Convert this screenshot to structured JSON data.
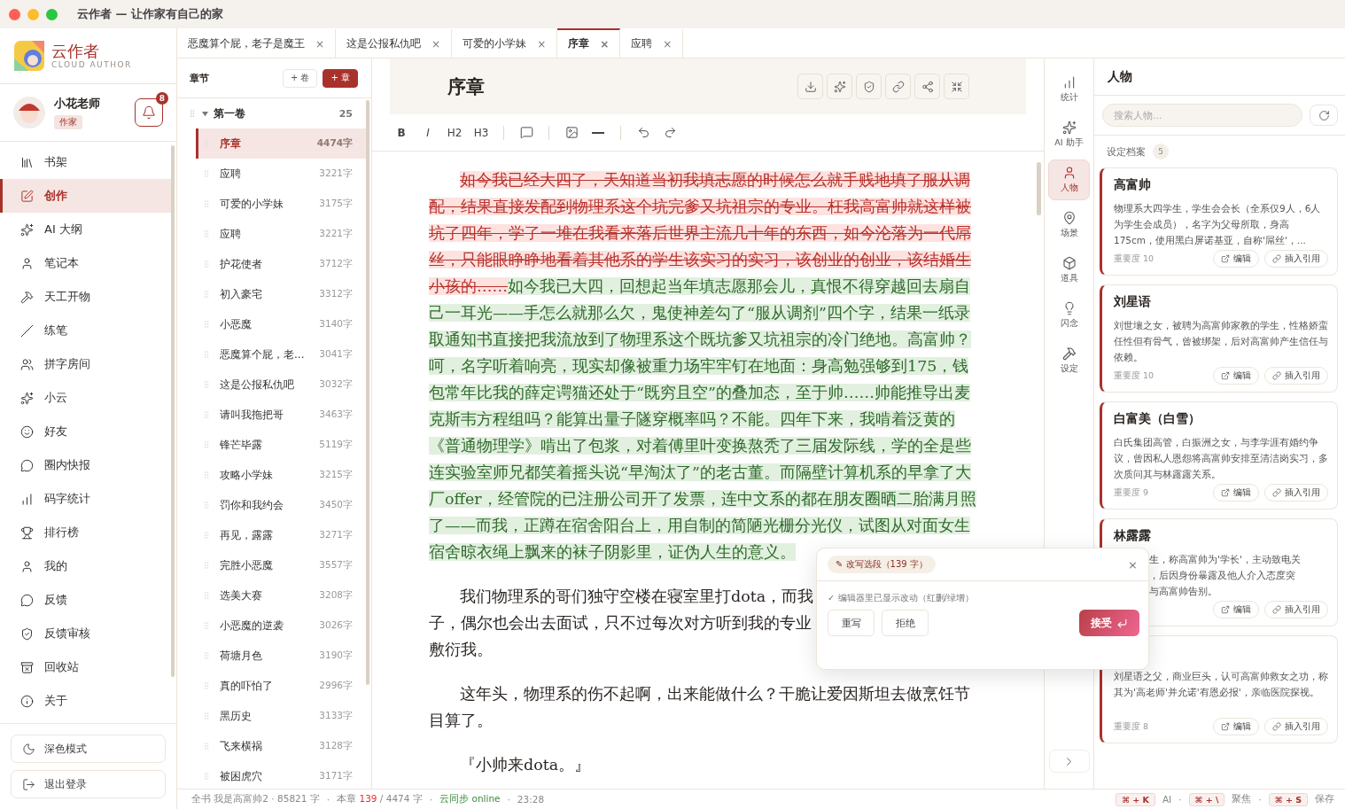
{
  "window": {
    "title": "云作者 — 让作家有自己的家"
  },
  "brand": {
    "name": "云作者",
    "subtitle": "CLOUD AUTHOR"
  },
  "user": {
    "name": "小花老师",
    "role": "作家",
    "notifications": "8"
  },
  "nav": [
    {
      "label": "书架",
      "selected": false
    },
    {
      "label": "创作",
      "selected": true
    },
    {
      "label": "AI 大纲",
      "selected": false
    },
    {
      "label": "笔记本",
      "selected": false
    },
    {
      "label": "天工开物",
      "selected": false
    },
    {
      "label": "练笔",
      "selected": false
    },
    {
      "label": "拼字房间",
      "selected": false
    },
    {
      "label": "小云",
      "selected": false
    },
    {
      "label": "好友",
      "selected": false
    },
    {
      "label": "圈内快报",
      "selected": false
    },
    {
      "label": "码字统计",
      "selected": false
    },
    {
      "label": "排行榜",
      "selected": false
    },
    {
      "label": "我的",
      "selected": false
    },
    {
      "label": "反馈",
      "selected": false
    },
    {
      "label": "反馈审核",
      "selected": false
    },
    {
      "label": "回收站",
      "selected": false
    },
    {
      "label": "关于",
      "selected": false
    }
  ],
  "sidebar_buttons": [
    "深色模式",
    "退出登录"
  ],
  "tabs": [
    {
      "label": "恶魔算个屁，老子是魔王",
      "selected": false,
      "close": "×"
    },
    {
      "label": "这是公报私仇吧",
      "selected": false,
      "close": "×"
    },
    {
      "label": "可爱的小学妹",
      "selected": false,
      "close": "×"
    },
    {
      "label": "序章",
      "selected": true,
      "close": "×"
    },
    {
      "label": "应聘",
      "selected": false,
      "close": "×"
    }
  ],
  "chapters": {
    "title": "章节",
    "buttons": [
      "+ 卷",
      "+ 章"
    ],
    "volume": {
      "title": "第一卷",
      "count": "25",
      "expanded": true
    },
    "items": [
      {
        "title": "序章",
        "words": "4474字",
        "selected": true
      },
      {
        "title": "应聘",
        "words": "3221字",
        "selected": false
      },
      {
        "title": "可爱的小学妹",
        "words": "3175字",
        "selected": false
      },
      {
        "title": "应聘",
        "words": "3221字",
        "selected": false
      },
      {
        "title": "护花使者",
        "words": "3712字",
        "selected": false
      },
      {
        "title": "初入豪宅",
        "words": "3312字",
        "selected": false
      },
      {
        "title": "小恶魔",
        "words": "3140字",
        "selected": false
      },
      {
        "title": "恶魔算个屁，老...",
        "words": "3041字",
        "selected": false
      },
      {
        "title": "这是公报私仇吧",
        "words": "3032字",
        "selected": false
      },
      {
        "title": "请叫我拖把哥",
        "words": "3463字",
        "selected": false
      },
      {
        "title": "锋芒毕露",
        "words": "5119字",
        "selected": false
      },
      {
        "title": "攻略小学妹",
        "words": "3215字",
        "selected": false
      },
      {
        "title": "罚你和我约会",
        "words": "3450字",
        "selected": false
      },
      {
        "title": "再见，露露",
        "words": "3271字",
        "selected": false
      },
      {
        "title": "完胜小恶魔",
        "words": "3557字",
        "selected": false
      },
      {
        "title": "选美大赛",
        "words": "3208字",
        "selected": false
      },
      {
        "title": "小恶魔的逆袭",
        "words": "3026字",
        "selected": false
      },
      {
        "title": "荷塘月色",
        "words": "3190字",
        "selected": false
      },
      {
        "title": "真的吓怕了",
        "words": "2996字",
        "selected": false
      },
      {
        "title": "黑历史",
        "words": "3133字",
        "selected": false
      },
      {
        "title": "飞来横祸",
        "words": "3128字",
        "selected": false
      },
      {
        "title": "被困虎穴",
        "words": "3171字",
        "selected": false
      }
    ]
  },
  "editor": {
    "title": "序章",
    "toolbar": [
      "B",
      "I",
      "H2",
      "H3"
    ],
    "paragraphs": [
      {
        "kind": "diff",
        "segments": [
          {
            "kind": "deleted",
            "text": "如今我已经大四了，天知道当初我填志愿的时候怎么就手贱地填了服从调配，结果直接发配到物理系这个坑完爹又坑祖宗的专业。枉我高富帅就这样被坑了四年，学了一堆在我看来落后世界主流几十年的东西，如今沦落为一代屌丝，只能眼睁睁地看着其他系的学生该实习的实习，该创业的创业，该结婚生小孩的……"
          },
          {
            "kind": "inserted",
            "text": "如今我已大四，回想起当年填志愿那会儿，真恨不得穿越回去扇自己一耳光——手怎么就那么欠，鬼使神差勾了“服从调剂”四个字，结果一纸录取通知书直接把我流放到了物理系这个既坑爹又坑祖宗的冷门绝地。高富帅？呵，名字听着响亮，现实却像被重力场牢牢钉在地面：身高勉强够到175，钱包常年比我的薛定谔猫还处于“既穷且空”的叠加态，至于帅……帅能推导出麦克斯韦方程组吗？能算出量子隧穿概率吗？不能。四年下来，我啃着泛黄的《普通物理学》啃出了包浆，对着傅里叶变换熬秃了三届发际线，学的全是些连实验室师兄都笑着摇头说“早淘汰了”的老古董。而隔壁计算机系的早拿了大厂offer，经管院的已注册公司开了发票，连中文系的都在朋友圈晒二胎满月照了——而我，正蹲在宿舍阳台上，用自制的简陋光栅分光仪，试图从对面女生宿舍晾衣绳上飘来的袜子阴影里，证伪人生的意义。"
          }
        ]
      },
      {
        "kind": "lines",
        "lines": [
          "我们物理系的哥们独守空楼在寝室里打dota，而我",
          "子，偶尔也会出去面试，只不过每次对方听到我的专业",
          "敷衍我。"
        ]
      },
      {
        "kind": "plain",
        "text": "这年头，物理系的伤不起啊，出来能做什么？干脆让爱因斯坦去做烹饪节目算了。"
      },
      {
        "kind": "plain",
        "text": "『小帅来dota。』"
      }
    ]
  },
  "rewrite_popup": {
    "tag": "✎ 改写选段（139 字）",
    "close": "×",
    "note": "✓ 编辑器里已显示改动（红删/绿增）",
    "buttons": [
      "重写",
      "拒绝"
    ],
    "accept": "接受"
  },
  "rail": [
    {
      "label": "统计",
      "selected": false
    },
    {
      "label": "AI 助手",
      "selected": false
    },
    {
      "label": "人物",
      "selected": true
    },
    {
      "label": "场景",
      "selected": false
    },
    {
      "label": "道具",
      "selected": false
    },
    {
      "label": "闪念",
      "selected": false
    },
    {
      "label": "设定",
      "selected": false
    }
  ],
  "panel": {
    "title": "人物",
    "search_placeholder": "搜索人物...",
    "section": "设定档案",
    "count": "5",
    "cards": [
      {
        "kind": "full",
        "name": "高富帅",
        "description": "物理系大四学生，学生会会长（全系仅9人，6人为学生会成员），名字为父母所取，身高175cm，使用黑白屏诺基亚，自称'屌丝'，...",
        "importance": "重要度 10",
        "actions": [
          "编辑",
          "插入引用"
        ]
      },
      {
        "kind": "full",
        "name": "刘星语",
        "description": "刘世壤之女，被聘为高富帅家教的学生，性格娇蛮任性但有骨气，曾被绑架，后对高富帅产生信任与依赖。",
        "importance": "重要度 10",
        "actions": [
          "编辑",
          "插入引用"
        ]
      },
      {
        "kind": "full",
        "name": "白富美（白雪）",
        "description": "白氏集团高管，白振洲之女，与李学涯有婚约争议，曾因私人恩怨将高富帅安排至清洁岗实习，多次质问其与林露露关系。",
        "importance": "重要度 9",
        "actions": [
          "编辑",
          "插入引用"
        ]
      },
      {
        "kind": "covered",
        "name": "林露露",
        "lines": [
          "生，称高富帅为'学长'，主动致电关",
          "，后因身份暴露及他人介入态度突",
          "与高富帅告别。"
        ],
        "actions": [
          "编辑",
          "插入引用"
        ]
      },
      {
        "kind": "full",
        "description": "刘星语之父，商业巨头，认可高富帅救女之功，称其为'高老师'并允诺'有恩必报'，亲临医院探视。",
        "importance": "重要度 8",
        "actions": [
          "编辑",
          "插入引用"
        ]
      }
    ]
  },
  "status_bar": {
    "segments": [
      {
        "kind": "plain",
        "text": "全书 我是高富帅2 · 85821 字"
      },
      {
        "kind": "separator",
        "text": "·"
      },
      {
        "kind": "chapter",
        "label": "本章",
        "count": "139",
        "total": "/ 4474 字"
      },
      {
        "kind": "separator",
        "text": "·"
      },
      {
        "kind": "sync",
        "text": "云同步 online"
      },
      {
        "kind": "separator",
        "text": "·"
      },
      {
        "kind": "plain",
        "text": "23:28"
      }
    ],
    "shortcuts": [
      {
        "kind": "key",
        "text": "⌘ + K"
      },
      {
        "kind": "label",
        "text": "AI"
      },
      {
        "kind": "separator",
        "text": "·"
      },
      {
        "kind": "key",
        "text": "⌘ + \\"
      },
      {
        "kind": "label",
        "text": "聚焦"
      },
      {
        "kind": "separator",
        "text": "·"
      },
      {
        "kind": "key",
        "text": "⌘ + S"
      },
      {
        "kind": "label",
        "text": "保存"
      }
    ]
  }
}
